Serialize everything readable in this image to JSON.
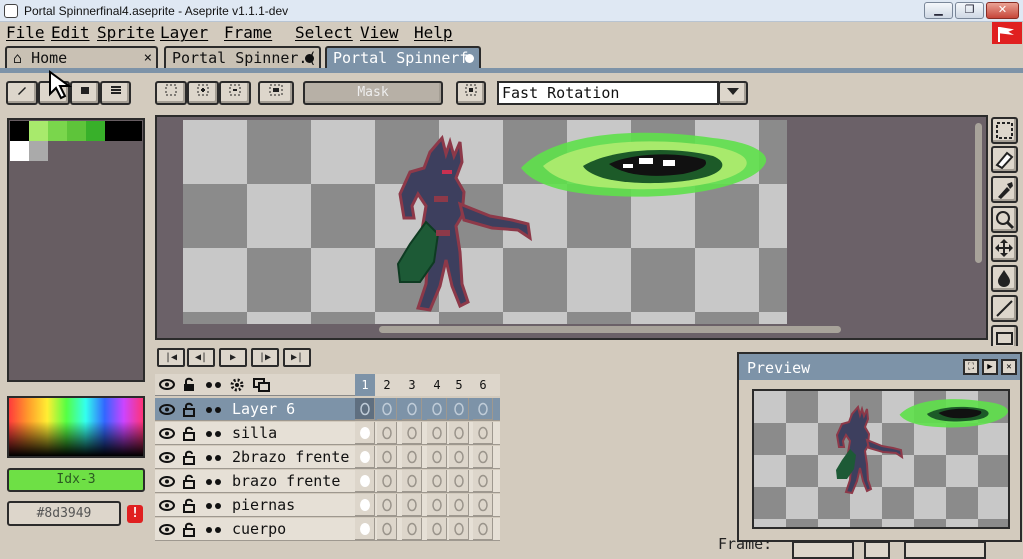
{
  "window": {
    "title": "Portal Spinnerfinal4.aseprite - Aseprite v1.1.1-dev",
    "buttons": {
      "minimize": "▁",
      "maximize": "❐",
      "close": "✕"
    }
  },
  "menu": {
    "items": [
      "File",
      "Edit",
      "Sprite",
      "Layer",
      "Frame",
      "Select",
      "View",
      "Help"
    ]
  },
  "tabs": [
    {
      "label": "Home",
      "icon": "home-icon",
      "close": "×"
    },
    {
      "label": "Portal Spinner.(",
      "dirty": true
    },
    {
      "label": "Portal Spinnerf",
      "dirty": true,
      "active": true
    }
  ],
  "toolbar": {
    "mask_label": "Mask",
    "selection_mode": "Fast Rotation"
  },
  "color_bar": {
    "foreground_label": "Idx-3",
    "background_label": "#8d3949",
    "accent": "#6ee045",
    "palette": [
      "#000000",
      "#a8ea6c",
      "#7ad64c",
      "#5ec43a",
      "#38b02a",
      "#000000",
      "#ffffff",
      "#aaaaaa"
    ]
  },
  "timeline": {
    "frames": [
      "1",
      "2",
      "3",
      "4",
      "5",
      "6"
    ],
    "layers": [
      {
        "name": "Layer 6",
        "selected": true
      },
      {
        "name": "silla"
      },
      {
        "name": "2brazo frente"
      },
      {
        "name": "brazo frente"
      },
      {
        "name": "piernas"
      },
      {
        "name": "cuerpo"
      }
    ]
  },
  "preview": {
    "title": "Preview"
  },
  "status": {
    "frame_label": "Frame:"
  },
  "colors": {
    "chrome": "#d3cbbe",
    "selected": "#7d93a8",
    "border": "#2b2b2b",
    "checker_light": "#c8c8c8",
    "checker_dark": "#8b8b8b",
    "sprite_dark": "#3d3f5e",
    "sprite_red": "#8d3949",
    "portal_green": "#5ee04a"
  }
}
